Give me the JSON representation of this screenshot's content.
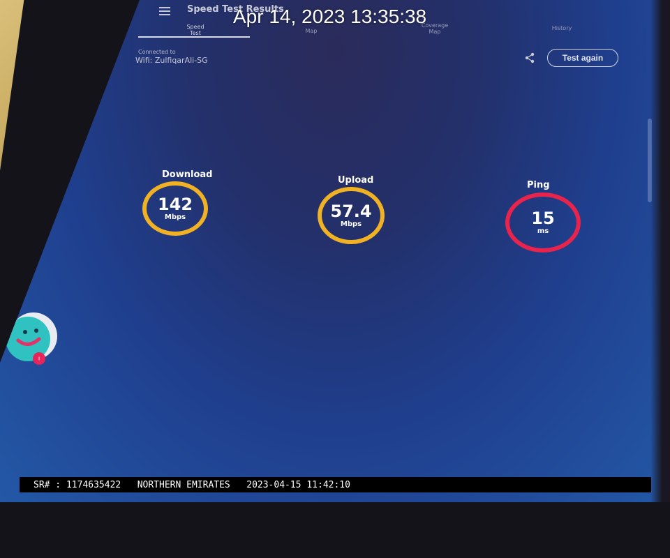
{
  "overlay": {
    "timestamp": "Apr 14, 2023 13:35:38"
  },
  "header": {
    "title": "Speed Test Results",
    "tabs": [
      {
        "label": "Speed\nTest",
        "active": true
      },
      {
        "label": "Map",
        "active": false
      },
      {
        "label": "Coverage\nMap",
        "active": false
      },
      {
        "label": "History",
        "active": false
      }
    ]
  },
  "connection": {
    "label": "Connected to",
    "value": "Wifi: ZulfiqarAli-SG"
  },
  "actions": {
    "test_again_label": "Test again",
    "share_icon": "share-icon"
  },
  "metrics": {
    "download": {
      "label": "Download",
      "value": "142",
      "unit": "Mbps",
      "color": "#f0b224"
    },
    "upload": {
      "label": "Upload",
      "value": "57.4",
      "unit": "Mbps",
      "color": "#f0b224"
    },
    "ping": {
      "label": "Ping",
      "value": "15",
      "unit": "ms",
      "color": "#e8244c"
    }
  },
  "caption": {
    "text": "SR# : 1174635422   NORTHERN EMIRATES   2023-04-15 11:42:10"
  },
  "colors": {
    "screen_bg": "#23306b",
    "accent_yellow": "#f0b224",
    "accent_red": "#e8244c"
  }
}
